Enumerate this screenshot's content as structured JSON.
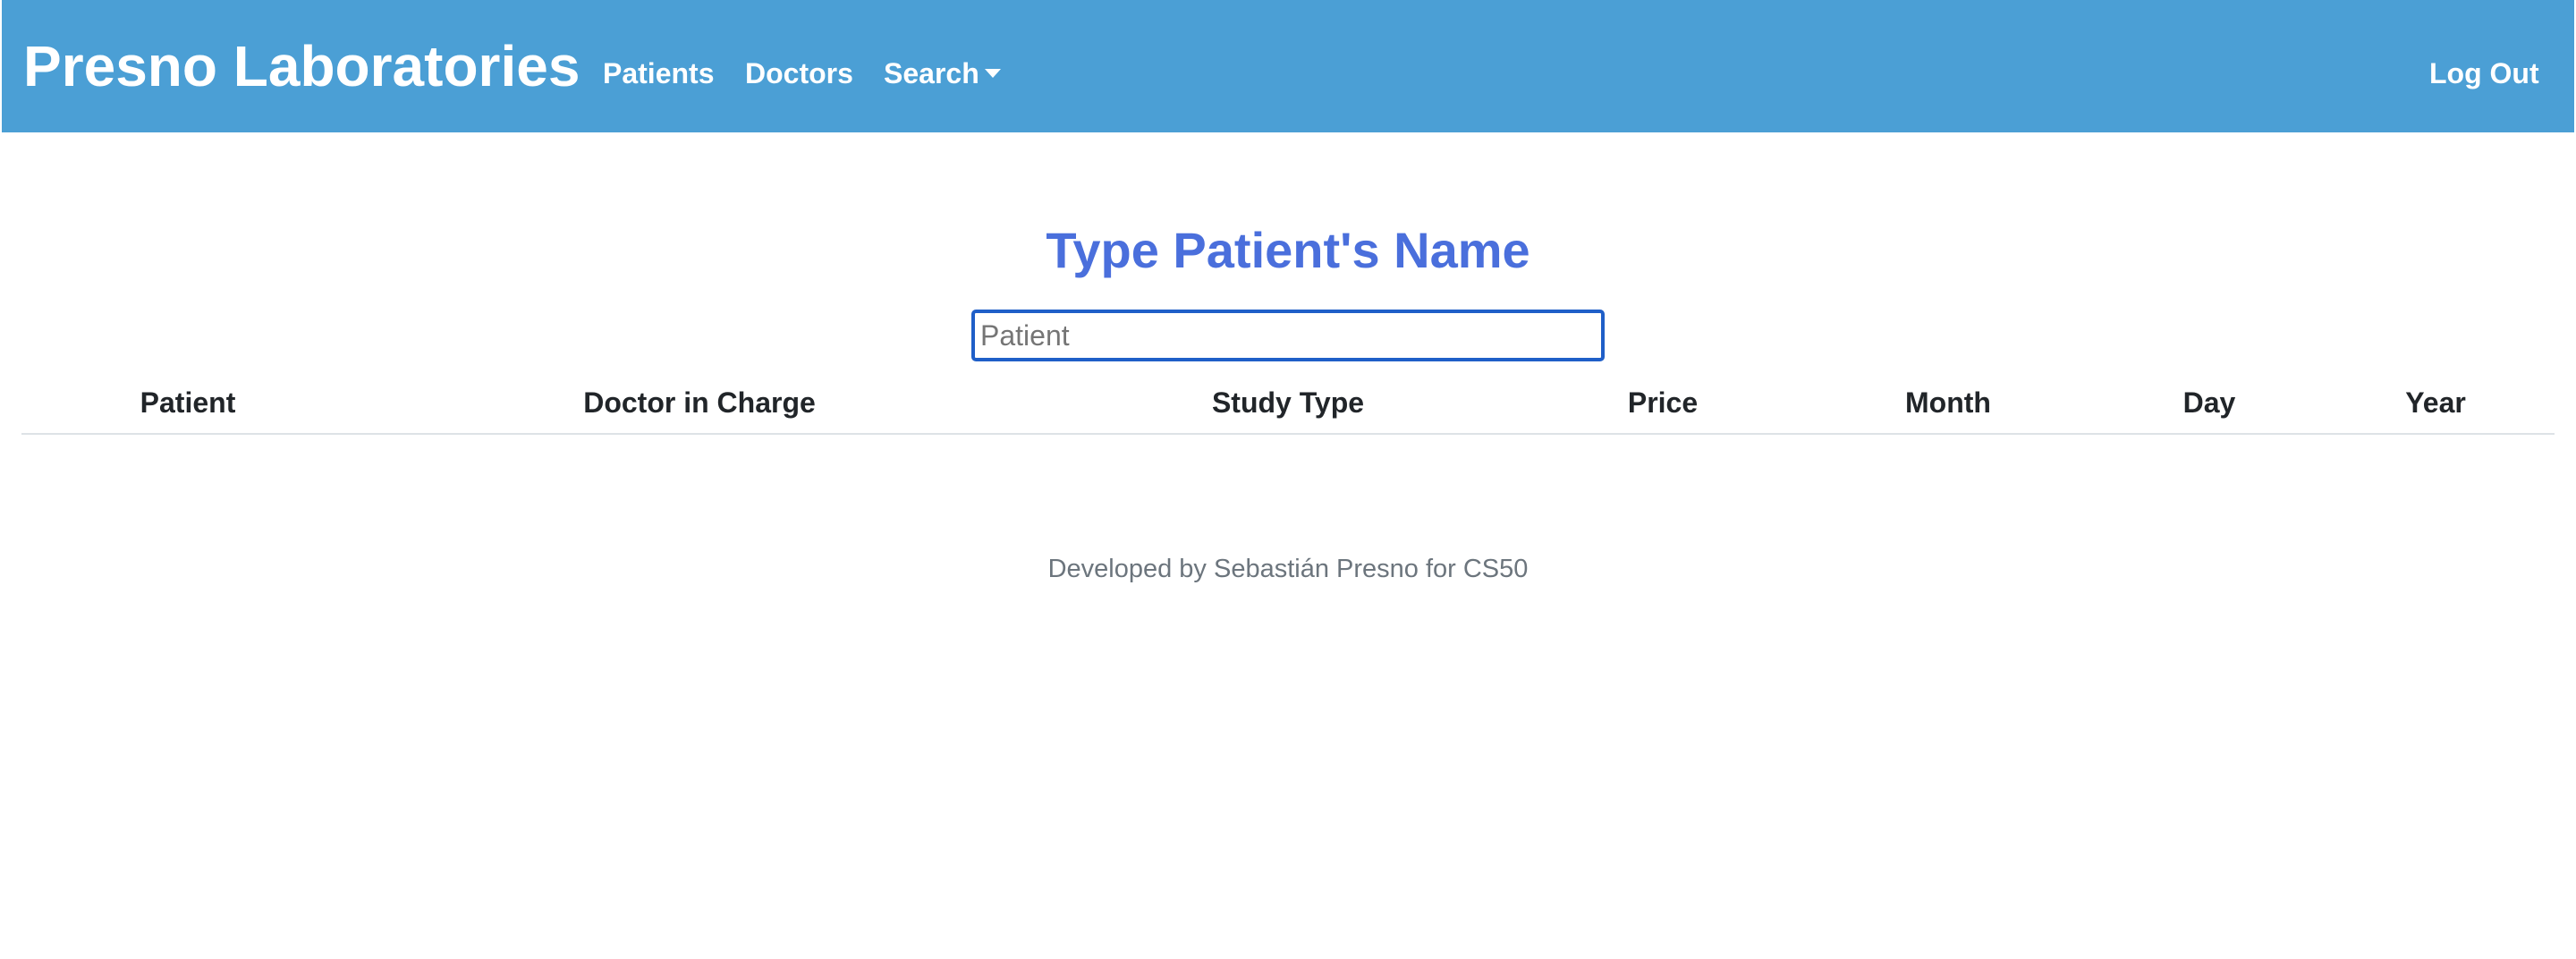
{
  "navbar": {
    "brand": "Presno Laboratories",
    "links": {
      "patients": "Patients",
      "doctors": "Doctors",
      "search": "Search",
      "logout": "Log Out"
    },
    "background_color": "#4b9fd5"
  },
  "main": {
    "title": "Type Patient's Name",
    "search": {
      "placeholder": "Patient",
      "value": ""
    },
    "table": {
      "headers": {
        "patient": "Patient",
        "doctor": "Doctor in Charge",
        "study": "Study Type",
        "price": "Price",
        "month": "Month",
        "day": "Day",
        "year": "Year"
      },
      "rows": []
    }
  },
  "footer": {
    "text": "Developed by Sebastián Presno for CS50"
  },
  "colors": {
    "title": "#4a6fdc",
    "input_border": "#1f5fc8"
  }
}
